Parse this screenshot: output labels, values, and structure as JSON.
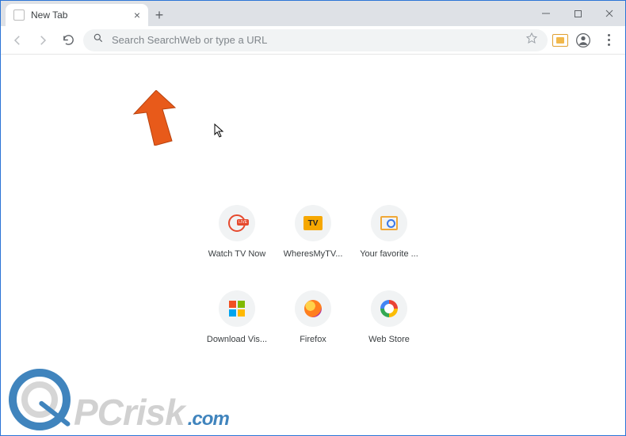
{
  "tab": {
    "title": "New Tab"
  },
  "omnibox": {
    "placeholder": "Search SearchWeb or type a URL"
  },
  "shortcuts": [
    {
      "label": "Watch TV Now",
      "icon": "globe-live"
    },
    {
      "label": "WheresMyTV...",
      "icon": "tv"
    },
    {
      "label": "Your favorite ...",
      "icon": "movie"
    },
    {
      "label": "Download Vis...",
      "icon": "microsoft"
    },
    {
      "label": "Firefox",
      "icon": "firefox"
    },
    {
      "label": "Web Store",
      "icon": "webstore"
    }
  ],
  "watermark": {
    "pc": "PC",
    "risk": "risk",
    "com": ".com"
  }
}
